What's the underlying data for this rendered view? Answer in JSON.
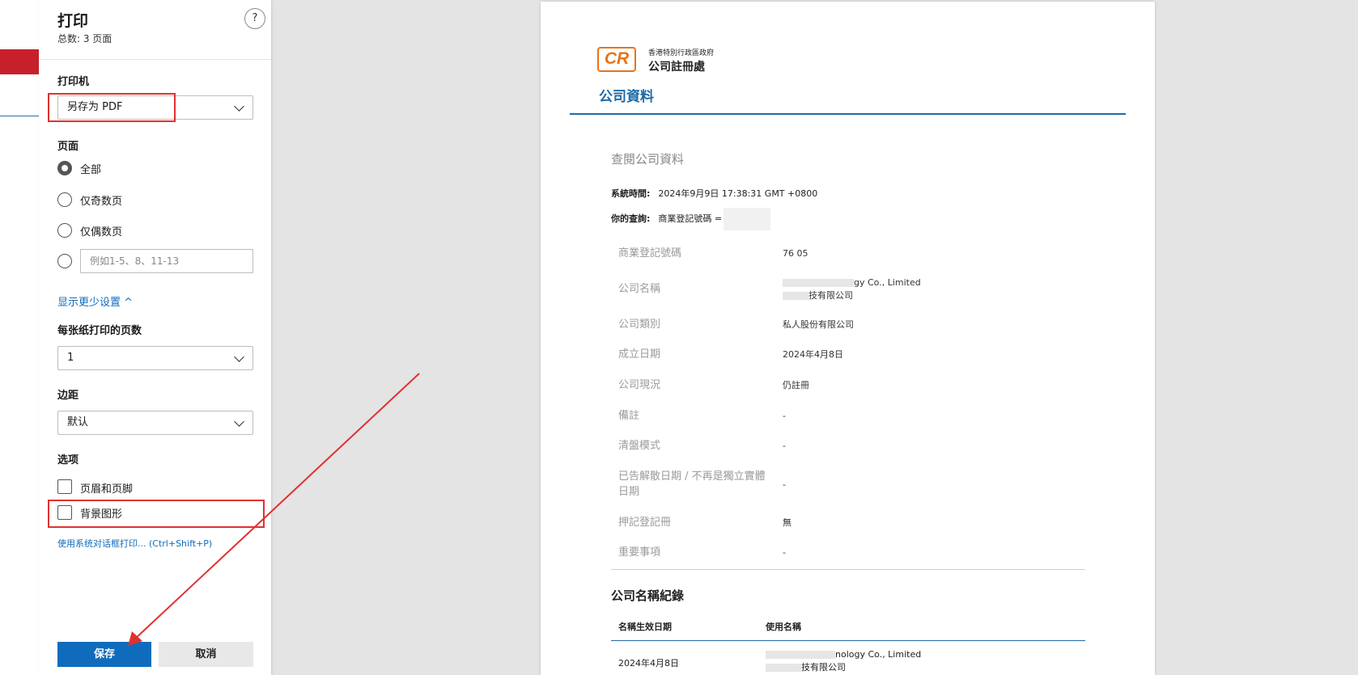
{
  "dialog": {
    "title": "打印",
    "subtitle": "总数: 3 页面",
    "help": "?",
    "printer_label": "打印机",
    "printer_value": "另存为 PDF",
    "pages_label": "页面",
    "pages_options": [
      "全部",
      "仅奇数页",
      "仅偶数页"
    ],
    "pages_selected": "全部",
    "range_placeholder": "例如1-5、8、11-13",
    "show_less": "显示更少设置 ^",
    "per_sheet_label": "每张纸打印的页数",
    "per_sheet_value": "1",
    "margins_label": "边距",
    "margins_value": "默认",
    "options_label": "选项",
    "option_headers": "页眉和页脚",
    "option_background": "背景图形",
    "system_dialog": "使用系统对话框打印... (Ctrl+Shift+P)",
    "save": "保存",
    "cancel": "取消"
  },
  "preview": {
    "logo_mark": "CR",
    "logo_line1": "香港特別行政區政府",
    "logo_line2": "公司註冊處",
    "heading": "公司資料",
    "subheading": "查閱公司資料",
    "system_time_label": "系統時間:",
    "system_time_value": "2024年9月9日 17:38:31 GMT +0800",
    "query_label": "你的查詢:",
    "query_value": "商業登記號碼 =",
    "rows": [
      {
        "label": "商業登記號碼",
        "value": "76      05"
      },
      {
        "label": "公司名稱",
        "value": "gy Co., Limited",
        "value2": "技有限公司"
      },
      {
        "label": "公司類別",
        "value": "私人股份有限公司"
      },
      {
        "label": "成立日期",
        "value": "2024年4月8日"
      },
      {
        "label": "公司現況",
        "value": "仍註冊"
      },
      {
        "label": "備註",
        "value": "-"
      },
      {
        "label": "清盤模式",
        "value": "-"
      },
      {
        "label": "已告解散日期 / 不再是獨立實體",
        "label2": "日期",
        "value": "-"
      },
      {
        "label": "押記登記冊",
        "value": "無"
      },
      {
        "label": "重要事項",
        "value": "-"
      }
    ],
    "name_record_title": "公司名稱紀錄",
    "name_record_headers": [
      "名稱生效日期",
      "使用名稱"
    ],
    "name_record_rows": [
      {
        "date": "2024年4月8日",
        "name": "nology Co., Limited",
        "name2": "技有限公司"
      }
    ]
  },
  "colors": {
    "accent": "#0f6cbd",
    "annotation": "#e03131",
    "logo": "#e8731a",
    "heading": "#1e6aa8"
  }
}
